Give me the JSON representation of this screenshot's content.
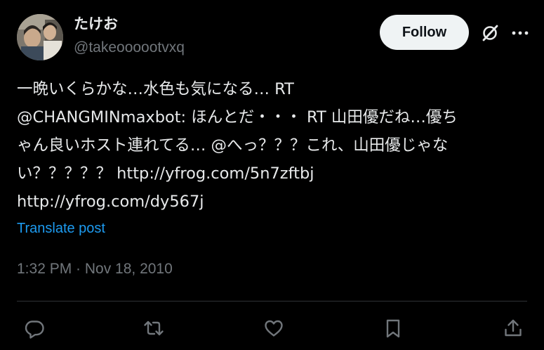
{
  "author": {
    "display_name": "たけお",
    "handle": "@takeoooootvxq"
  },
  "header": {
    "follow_label": "Follow",
    "grok_icon": "grok-icon",
    "more_icon": "more-options-icon"
  },
  "post": {
    "lines": [
      "一晩いくらかな…水色も気になる… RT",
      "@CHANGMINmaxbot: ほんとだ・・・ RT 山田優だね…優ち",
      "ゃん良いホスト連れてる… @へっ？？？これ、山田優じゃな",
      "い？？？？？ http://yfrog.com/5n7zftbj",
      "http://yfrog.com/dy567j"
    ],
    "translate_label": "Translate post",
    "timestamp": "1:32 PM · Nov 18, 2010"
  },
  "actions": {
    "reply_icon": "reply-icon",
    "repost_icon": "repost-icon",
    "like_icon": "like-icon",
    "bookmark_icon": "bookmark-icon",
    "share_icon": "share-icon"
  },
  "colors": {
    "background": "#000000",
    "text_primary": "#e7e9ea",
    "text_secondary": "#71767b",
    "link": "#1d9bf0",
    "follow_button_bg": "#eff3f4",
    "divider": "#2f3336"
  }
}
